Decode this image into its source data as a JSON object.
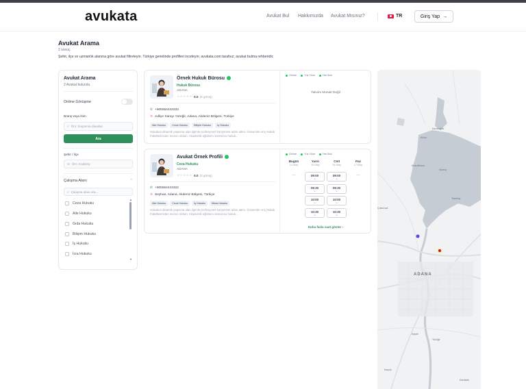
{
  "header": {
    "logo": "avukata",
    "nav": [
      "Avukat Bul",
      "Hakkımızda",
      "Avukat Mısınız?"
    ],
    "lang": "TR",
    "login_label": "Giriş Yap"
  },
  "page": {
    "title": "Avukat Arama",
    "count": "2 sonuç",
    "description": "Şehir, ilçe ve uzmanlık alanına göre avukat filtreleyin. Türkiye genelinde profilleri inceleyin; avukata.com tarafsız; avukat bulma rehberidir."
  },
  "sidebar": {
    "title": "Avukat Arama",
    "found": "2 Avukat bulundu",
    "online_label": "Online Görüşme",
    "branch_label": "Branş veya İsim",
    "branch_placeholder": "Örn: boşanma davaları",
    "search_button": "Ara",
    "city_label": "Şehir / İlçe",
    "city_placeholder": "Örn: Kadıköy",
    "areas_title": "Çalışma Alanı",
    "areas_placeholder": "Çalışma alanı ara...",
    "areas": [
      "Ceza Hukuku",
      "Aile Hukuku",
      "Gıda Hukuku",
      "Bilişim Hukuku",
      "İş Hukuku",
      "İcra Hukuku"
    ]
  },
  "legend": [
    "Online",
    "Yüz Yüze",
    "Her İkisi"
  ],
  "cards": [
    {
      "name": "Örnek Hukuk Bürosu",
      "specialty": "Hukuk Bürosu",
      "city": "ADANA",
      "stars": "☆☆☆☆☆",
      "rating": "0.0",
      "reviews": "(0 görüş)",
      "phone": "+905554443333",
      "address": "Adliye Sarayı Yüreğir, Adana, Akdeniz Bölgesi, Türkiye",
      "tags": [
        "Aile Hukuku",
        "Ceza Hukuku",
        "Bilişim Hukuku",
        "İş Hukuku"
      ],
      "description": "Hukukun dinamik yapısına olan ilgimle profesyonel kariyerime adım attım. Üniversite Ariç Hukuk Fakültesi'nden mezun oldum. Akademik eğitimim süresince hukuk...",
      "calendar_message": "Takvim Müsait Değil"
    },
    {
      "name": "Avukat Örnek Profili",
      "specialty": "Ceza Hukuku",
      "city": "ADANA",
      "stars": "☆☆☆☆☆",
      "rating": "0.0",
      "reviews": "(0 görüş)",
      "phone": "+905554443322",
      "address": "Seyhan, Adana, Akdeniz Bölgesi, Türkiye",
      "tags": [
        "Aile Hukuku",
        "Ceza Hukuku",
        "İş Hukuku",
        "Miras Hukuku"
      ],
      "description": "Hukukun dinamik yapısına olan ilgimle profesyonel kariyerime adım attım. Üniversite Ariç Hukuk Fakültesi'nden mezun oldum. Akademik eğitimim süresince hukuk...",
      "days": [
        {
          "name": "Bugün",
          "date": "14 May"
        },
        {
          "name": "Yarın",
          "date": "15 May"
        },
        {
          "name": "Cmt",
          "date": "16 May"
        },
        {
          "name": "Paz",
          "date": "17 May"
        }
      ],
      "slots_col2": [
        "09:00",
        "09:30",
        "10:00",
        "10:30"
      ],
      "slots_col3": [
        "09:00",
        "09:30",
        "10:00",
        "10:30"
      ],
      "more_label": "Daha fazla saat göster"
    }
  ],
  "map": {
    "labels": [
      "Kılıçlı",
      "Karahöyük",
      "Karaisalı",
      "Tepeköy",
      "Akarca",
      "Çukurova",
      "ADANA",
      "Yüreğir",
      "Kepirli",
      "Kayışlı",
      "Kiremithane"
    ],
    "water_color": "#c6ccd3",
    "land_color": "#f3f4f5",
    "marker_blue": "#4f46e5",
    "marker_red": "#b91c1c"
  },
  "colors": {
    "accent": "#2f8f5b",
    "online": "#22c55e"
  }
}
